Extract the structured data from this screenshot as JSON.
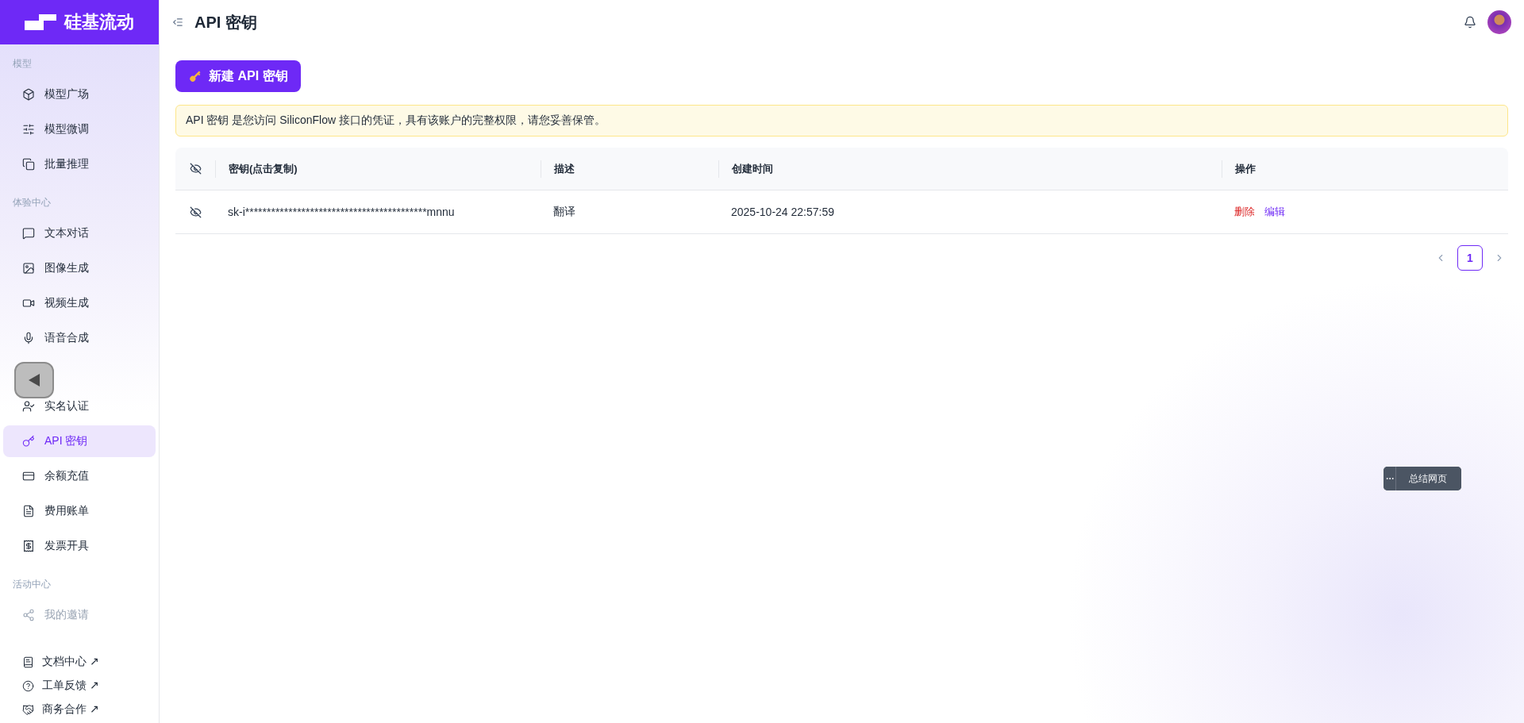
{
  "logo": {
    "text": "硅基流动"
  },
  "header": {
    "title": "API 密钥"
  },
  "sidebar": {
    "sections": [
      {
        "label": "模型",
        "items": [
          {
            "label": "模型广场",
            "selected": false,
            "disabled": false
          },
          {
            "label": "模型微调",
            "selected": false,
            "disabled": false
          },
          {
            "label": "批量推理",
            "selected": false,
            "disabled": false
          }
        ]
      },
      {
        "label": "体验中心",
        "items": [
          {
            "label": "文本对话",
            "selected": false,
            "disabled": false
          },
          {
            "label": "图像生成",
            "selected": false,
            "disabled": false
          },
          {
            "label": "视频生成",
            "selected": false,
            "disabled": false
          },
          {
            "label": "语音合成",
            "selected": false,
            "disabled": false
          }
        ]
      },
      {
        "items": [
          {
            "label": "实名认证",
            "selected": false,
            "disabled": false
          },
          {
            "label": "API 密钥",
            "selected": true,
            "disabled": false
          },
          {
            "label": "余额充值",
            "selected": false,
            "disabled": false
          },
          {
            "label": "费用账单",
            "selected": false,
            "disabled": false
          },
          {
            "label": "发票开具",
            "selected": false,
            "disabled": false
          }
        ]
      },
      {
        "label": "活动中心",
        "items": [
          {
            "label": "我的邀请",
            "selected": false,
            "disabled": true
          }
        ]
      }
    ],
    "links": [
      {
        "label": "文档中心",
        "suffix": "↗"
      },
      {
        "label": "工单反馈",
        "suffix": "↗"
      },
      {
        "label": "商务合作",
        "suffix": "↗"
      }
    ]
  },
  "new_key_button": {
    "label": "新建 API 密钥"
  },
  "notice": {
    "text": "API 密钥 是您访问 SiliconFlow 接口的凭证，具有该账户的完整权限，请您妥善保管。"
  },
  "table": {
    "columns": [
      "密钥(点击复制)",
      "描述",
      "创建时间",
      "操作"
    ],
    "rows": [
      {
        "key": "sk-i******************************************mnnu",
        "description": "翻译",
        "created": "2025-10-24 22:57:59",
        "actions": [
          {
            "label": "删除",
            "kind": "danger"
          },
          {
            "label": "编辑",
            "kind": "primary"
          }
        ]
      }
    ]
  },
  "pagination": {
    "pages": [
      {
        "label": "1",
        "selected": true
      }
    ]
  },
  "floating_tool": {
    "label": "总结网页"
  }
}
